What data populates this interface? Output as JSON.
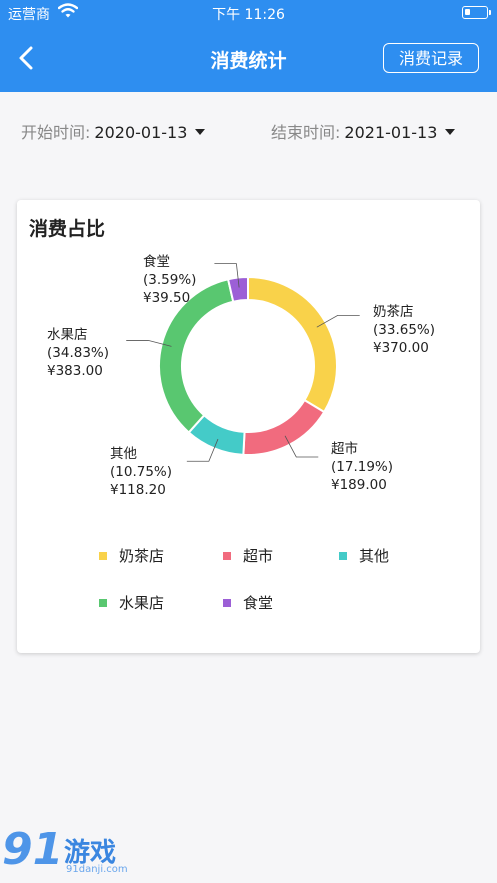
{
  "status_bar": {
    "carrier": "运营商",
    "time": "下午 11:26"
  },
  "header": {
    "title": "消费统计",
    "records_button": "消费记录",
    "background": "#2e8ef0"
  },
  "filters": {
    "start_label": "开始时间:",
    "start_value": "2020-01-13",
    "end_label": "结束时间:",
    "end_value": "2021-01-13"
  },
  "card": {
    "title": "消费占比"
  },
  "chart_data": {
    "type": "pie",
    "donut": true,
    "title": "消费占比",
    "legend_placement": "bottom",
    "slices": [
      {
        "name": "奶茶店",
        "percent_label": "(33.65%)",
        "amount_label": "¥370.00",
        "value": 370.0,
        "color": "#f9d24a"
      },
      {
        "name": "超市",
        "percent_label": "(17.19%)",
        "amount_label": "¥189.00",
        "value": 189.0,
        "color": "#f16b7e"
      },
      {
        "name": "其他",
        "percent_label": "(10.75%)",
        "amount_label": "¥118.20",
        "value": 118.2,
        "color": "#44cbc8"
      },
      {
        "name": "水果店",
        "percent_label": "(34.83%)",
        "amount_label": "¥383.00",
        "value": 383.0,
        "color": "#59c770"
      },
      {
        "name": "食堂",
        "percent_label": "(3.59%)",
        "amount_label": "¥39.50",
        "value": 39.5,
        "color": "#9c5fd6"
      }
    ]
  },
  "watermark": {
    "number": "91",
    "text": "游戏",
    "url": "91danji.com"
  }
}
